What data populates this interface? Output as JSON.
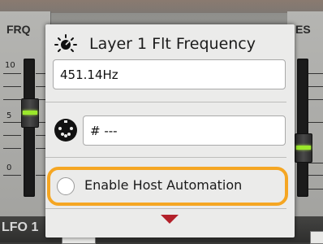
{
  "background": {
    "left_label": "FRQ",
    "right_label": "ES",
    "scale": [
      "10",
      "5",
      "0"
    ],
    "bottom_label": "LFO 1"
  },
  "popup": {
    "title": "Layer 1 Flt Frequency",
    "title_icon": "tuning-knob-icon",
    "value_field": "451.14Hz",
    "midi_icon": "midi-din-icon",
    "midi_field": "# ---",
    "automation": {
      "label": "Enable Host Automation",
      "checked": false,
      "highlight_color": "#f5a623"
    },
    "more_indicator": "chevron-down-icon",
    "more_color": "#b3202a"
  }
}
